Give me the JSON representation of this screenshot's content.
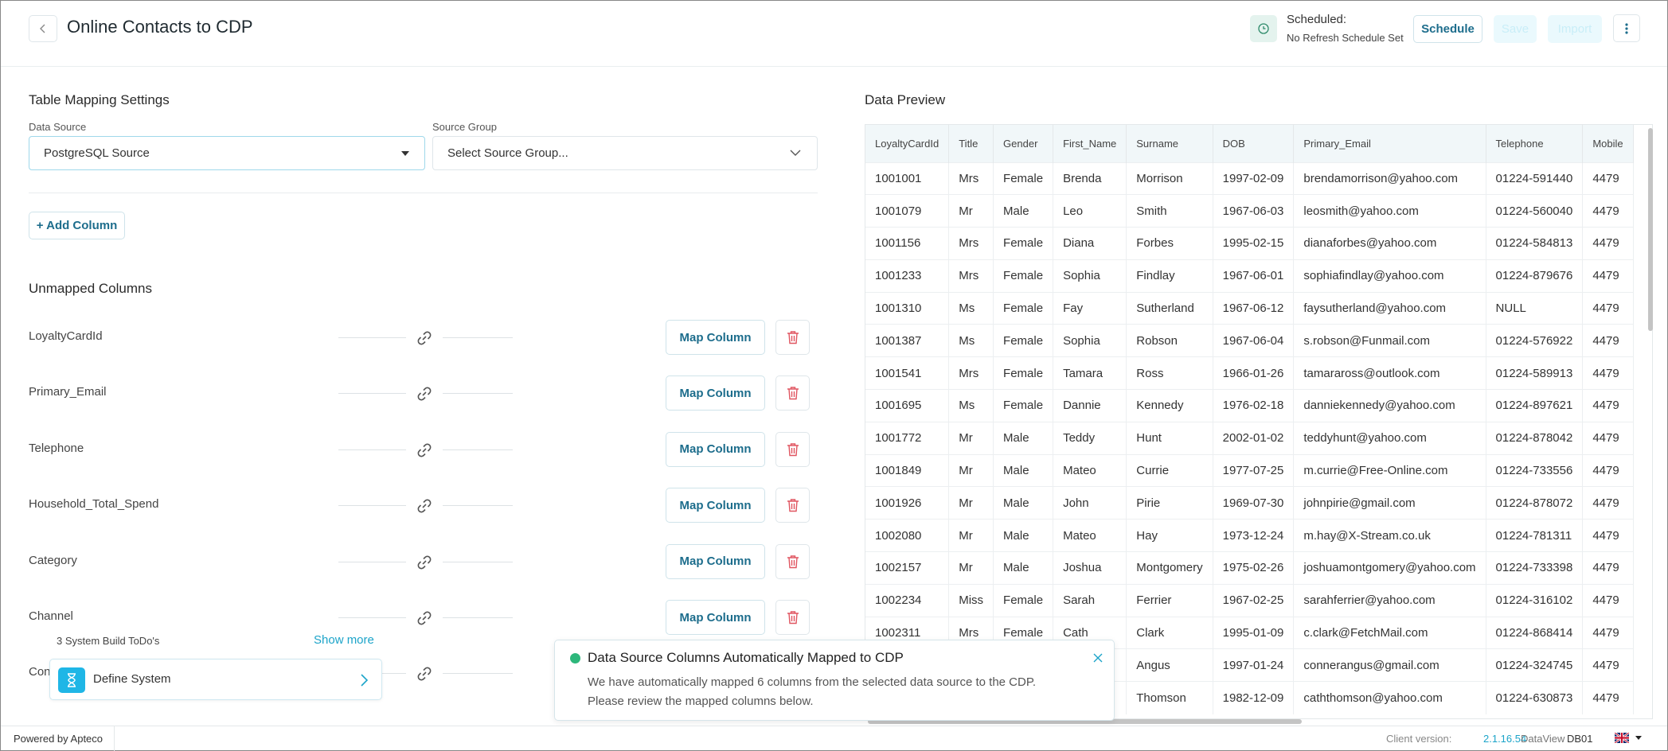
{
  "header": {
    "title": "Online Contacts to CDP",
    "schedule_label": "Scheduled:",
    "schedule_value": "No Refresh Schedule Set",
    "schedule_button": "Schedule",
    "save_button": "Save",
    "import_button": "Import"
  },
  "mapping": {
    "title": "Table Mapping Settings",
    "data_source_label": "Data Source",
    "data_source_value": "PostgreSQL Source",
    "source_group_label": "Source Group",
    "source_group_placeholder": "Select Source Group...",
    "add_column": "+ Add Column"
  },
  "unmapped": {
    "title": "Unmapped Columns",
    "map_label": "Map Column",
    "columns": [
      "LoyaltyCardId",
      "Primary_Email",
      "Telephone",
      "Household_Total_Spend",
      "Category",
      "Channel",
      "Con"
    ]
  },
  "todo": {
    "count_text": "3 System Build ToDo's",
    "show_more": "Show more",
    "item_label": "Define System"
  },
  "preview": {
    "title": "Data Preview",
    "headers": [
      "LoyaltyCardId",
      "Title",
      "Gender",
      "First_Name",
      "Surname",
      "DOB",
      "Primary_Email",
      "Telephone",
      "Mobile"
    ],
    "rows": [
      [
        "1001001",
        "Mrs",
        "Female",
        "Brenda",
        "Morrison",
        "1997-02-09",
        "brendamorrison@yahoo.com",
        "01224-591440",
        "4479"
      ],
      [
        "1001079",
        "Mr",
        "Male",
        "Leo",
        "Smith",
        "1967-06-03",
        "leosmith@yahoo.com",
        "01224-560040",
        "4479"
      ],
      [
        "1001156",
        "Mrs",
        "Female",
        "Diana",
        "Forbes",
        "1995-02-15",
        "dianaforbes@yahoo.com",
        "01224-584813",
        "4479"
      ],
      [
        "1001233",
        "Mrs",
        "Female",
        "Sophia",
        "Findlay",
        "1967-06-01",
        "sophiafindlay@yahoo.com",
        "01224-879676",
        "4479"
      ],
      [
        "1001310",
        "Ms",
        "Female",
        "Fay",
        "Sutherland",
        "1967-06-12",
        "faysutherland@yahoo.com",
        "NULL",
        "4479"
      ],
      [
        "1001387",
        "Ms",
        "Female",
        "Sophia",
        "Robson",
        "1967-06-04",
        "s.robson@Funmail.com",
        "01224-576922",
        "4479"
      ],
      [
        "1001541",
        "Mrs",
        "Female",
        "Tamara",
        "Ross",
        "1966-01-26",
        "tamaraross@outlook.com",
        "01224-589913",
        "4479"
      ],
      [
        "1001695",
        "Ms",
        "Female",
        "Dannie",
        "Kennedy",
        "1976-02-18",
        "danniekennedy@yahoo.com",
        "01224-897621",
        "4479"
      ],
      [
        "1001772",
        "Mr",
        "Male",
        "Teddy",
        "Hunt",
        "2002-01-02",
        "teddyhunt@yahoo.com",
        "01224-878042",
        "4479"
      ],
      [
        "1001849",
        "Mr",
        "Male",
        "Mateo",
        "Currie",
        "1977-07-25",
        "m.currie@Free-Online.com",
        "01224-733556",
        "4479"
      ],
      [
        "1001926",
        "Mr",
        "Male",
        "John",
        "Pirie",
        "1969-07-30",
        "johnpirie@gmail.com",
        "01224-878072",
        "4479"
      ],
      [
        "1002080",
        "Mr",
        "Male",
        "Mateo",
        "Hay",
        "1973-12-24",
        "m.hay@X-Stream.co.uk",
        "01224-781311",
        "4479"
      ],
      [
        "1002157",
        "Mr",
        "Male",
        "Joshua",
        "Montgomery",
        "1975-02-26",
        "joshuamontgomery@yahoo.com",
        "01224-733398",
        "4479"
      ],
      [
        "1002234",
        "Miss",
        "Female",
        "Sarah",
        "Ferrier",
        "1967-02-25",
        "sarahferrier@yahoo.com",
        "01224-316102",
        "4479"
      ],
      [
        "1002311",
        "Mrs",
        "Female",
        "Cath",
        "Clark",
        "1995-01-09",
        "c.clark@FetchMail.com",
        "01224-868414",
        "4479"
      ],
      [
        "",
        "",
        "",
        "",
        "Angus",
        "1997-01-24",
        "connerangus@gmail.com",
        "01224-324745",
        "4479"
      ],
      [
        "",
        "",
        "",
        "",
        "Thomson",
        "1982-12-09",
        "caththomson@yahoo.com",
        "01224-630873",
        "4479"
      ]
    ]
  },
  "toast": {
    "title": "Data Source Columns Automatically Mapped to CDP",
    "line1": "We have automatically mapped 6 columns from the selected data source to the CDP.",
    "line2": "Please review the mapped columns below."
  },
  "footer": {
    "powered_by": "Powered by Apteco",
    "client_version_label": "Client version:",
    "client_version": "2.1.16.54",
    "dataview_label": "DataView",
    "dataview_value": "DB01"
  },
  "colors": {
    "accent": "#1d6d8c",
    "link": "#1ca4c9",
    "success": "#2db77b",
    "danger": "#e05560"
  },
  "icons": {
    "back": "chevron-left-icon",
    "schedule": "clock-icon",
    "more": "kebab-menu-icon",
    "link": "link-icon",
    "delete": "trash-icon",
    "todo": "hourglass-icon",
    "close": "close-icon",
    "flag": "uk-flag-icon"
  }
}
